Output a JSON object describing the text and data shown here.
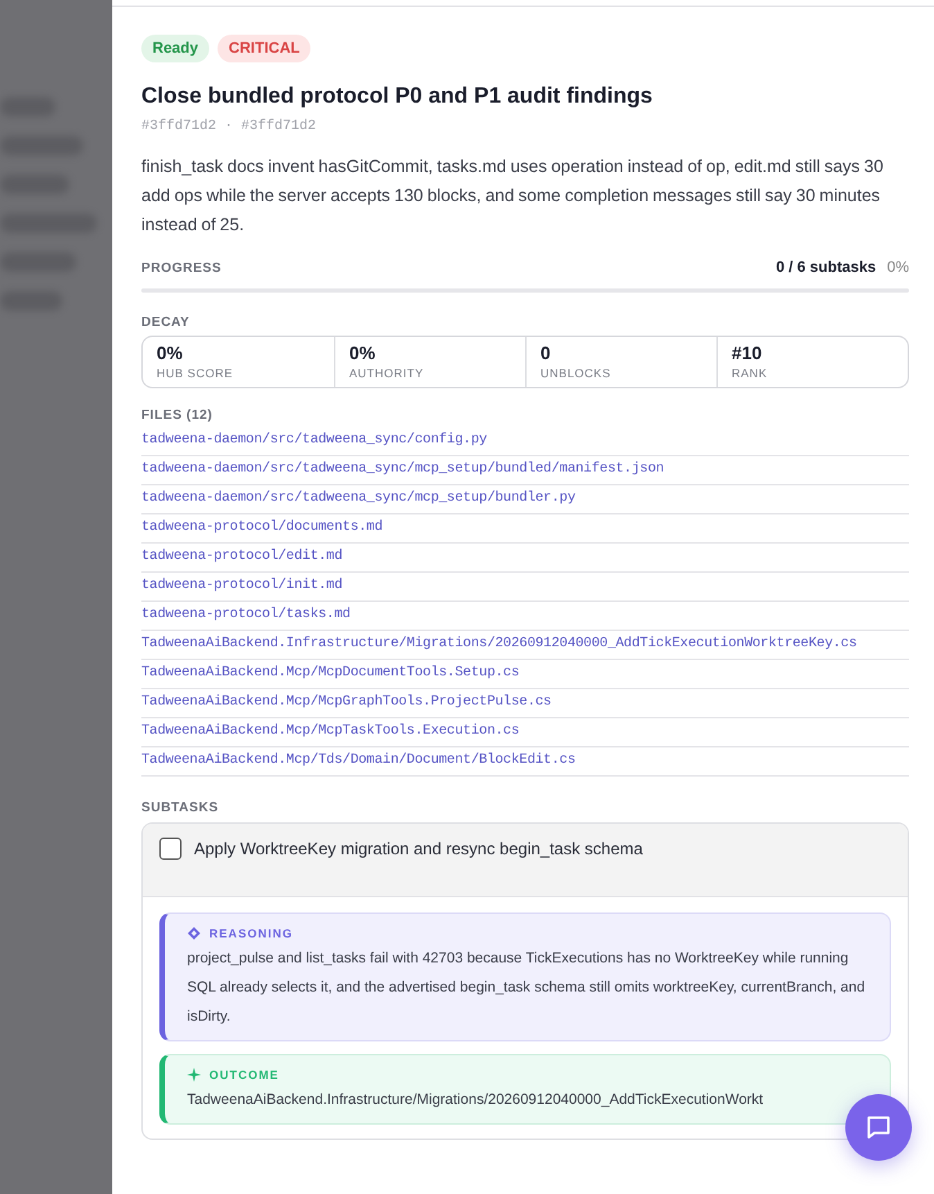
{
  "badges": [
    {
      "label": "Ready",
      "kind": "status"
    },
    {
      "label": "CRITICAL",
      "kind": "priority"
    }
  ],
  "title": "Close bundled protocol P0 and P1 audit findings",
  "ids": [
    "#3ffd71d2",
    "#3ffd71d2"
  ],
  "id_separator": "·",
  "description": "finish_task docs invent hasGitCommit, tasks.md uses operation instead of op, edit.md still says 30 add ops while the server accepts 130 blocks, and some completion messages still say 30 minutes instead of 25.",
  "progress": {
    "label": "PROGRESS",
    "count": "0 / 6 subtasks",
    "percent": "0%",
    "level": 0
  },
  "decay": {
    "label": "DECAY",
    "stats": [
      {
        "value": "0%",
        "label": "HUB SCORE"
      },
      {
        "value": "0%",
        "label": "AUTHORITY"
      },
      {
        "value": "0",
        "label": "UNBLOCKS"
      },
      {
        "value": "#10",
        "label": "RANK"
      }
    ]
  },
  "files": {
    "label": "FILES (12)",
    "items": [
      "tadweena-daemon/src/tadweena_sync/config.py",
      "tadweena-daemon/src/tadweena_sync/mcp_setup/bundled/manifest.json",
      "tadweena-daemon/src/tadweena_sync/mcp_setup/bundler.py",
      "tadweena-protocol/documents.md",
      "tadweena-protocol/edit.md",
      "tadweena-protocol/init.md",
      "tadweena-protocol/tasks.md",
      "TadweenaAiBackend.Infrastructure/Migrations/20260912040000_AddTickExecutionWorktreeKey.cs",
      "TadweenaAiBackend.Mcp/McpDocumentTools.Setup.cs",
      "TadweenaAiBackend.Mcp/McpGraphTools.ProjectPulse.cs",
      "TadweenaAiBackend.Mcp/McpTaskTools.Execution.cs",
      "TadweenaAiBackend.Mcp/Tds/Domain/Document/BlockEdit.cs"
    ]
  },
  "subtasks": {
    "label": "SUBTASKS",
    "items": [
      {
        "title": "Apply WorktreeKey migration and resync begin_task schema",
        "checked": false,
        "expanded": true,
        "notes": [
          {
            "kind": "reasoning",
            "label": "REASONING",
            "text": "project_pulse and list_tasks fail with 42703 because TickExecutions has no WorktreeKey while running SQL already selects it, and the advertised begin_task schema still omits worktreeKey, currentBranch, and isDirty."
          },
          {
            "kind": "outcome",
            "label": "OUTCOME",
            "text": "TadweenaAiBackend.Infrastructure/Migrations/20260912040000_AddTickExecutionWorkt"
          }
        ]
      }
    ]
  }
}
